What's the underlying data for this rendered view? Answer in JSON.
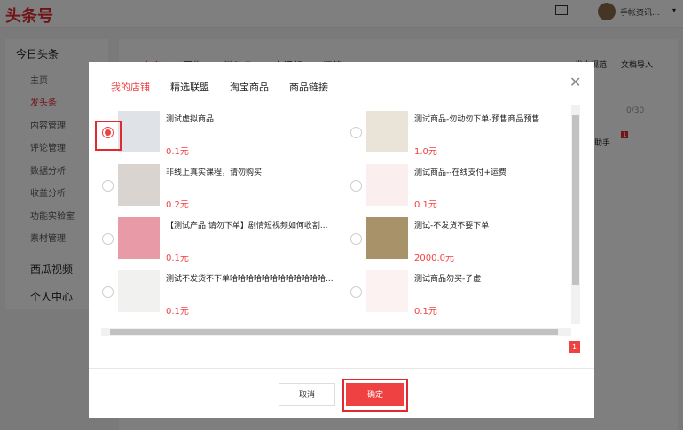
{
  "header": {
    "logo": "头条号",
    "username": "手帐资讯...",
    "caret": "▾"
  },
  "sidebar": {
    "group": "今日头条",
    "items": [
      "主页",
      "发头条",
      "内容管理",
      "评论管理",
      "数据分析",
      "收益分析",
      "功能实验室",
      "素材管理"
    ],
    "groups2": [
      "西瓜视频",
      "个人中心"
    ]
  },
  "main": {
    "tabs": [
      "文章",
      "图集",
      "微头条",
      "小视频",
      "问答"
    ],
    "links": [
      "发文规范",
      "文档导入"
    ],
    "counter": "0/30",
    "assistant": "发文助手",
    "badge": "1"
  },
  "modal": {
    "tabs": [
      "我的店铺",
      "精选联盟",
      "淘宝商品",
      "商品链接"
    ],
    "close": "✕",
    "products": [
      {
        "title": "测试虚拟商品",
        "price": "0.1元",
        "selected": true,
        "thumb": "#dfe3e8"
      },
      {
        "title": "测试商品-勿动勿下单-预售商品预售",
        "price": "1.0元",
        "selected": false,
        "thumb": "#e9e3d8"
      },
      {
        "title": "非线上真实课程，请勿购买",
        "price": "0.2元",
        "selected": false,
        "thumb": "#d9d4d0"
      },
      {
        "title": "测试商品--在线支付+运费",
        "price": "0.1元",
        "selected": false,
        "thumb": "#fbeeee"
      },
      {
        "title": "【测试产品 请勿下单】剧情短视频如何收割...",
        "price": "0.1元",
        "selected": false,
        "thumb": "#e89aa6"
      },
      {
        "title": "测试-不发货不要下单",
        "price": "2000.0元",
        "selected": false,
        "thumb": "#a8926a"
      },
      {
        "title": "测试不发货不下单哈哈哈哈哈哈哈哈哈哈哈哈...",
        "price": "0.1元",
        "selected": false,
        "thumb": "#f1f1ef"
      },
      {
        "title": "测试商品勿买-子虚",
        "price": "0.1元",
        "selected": false,
        "thumb": "#fdf2f2"
      }
    ],
    "page": "1",
    "cancel": "取消",
    "confirm": "确定"
  }
}
